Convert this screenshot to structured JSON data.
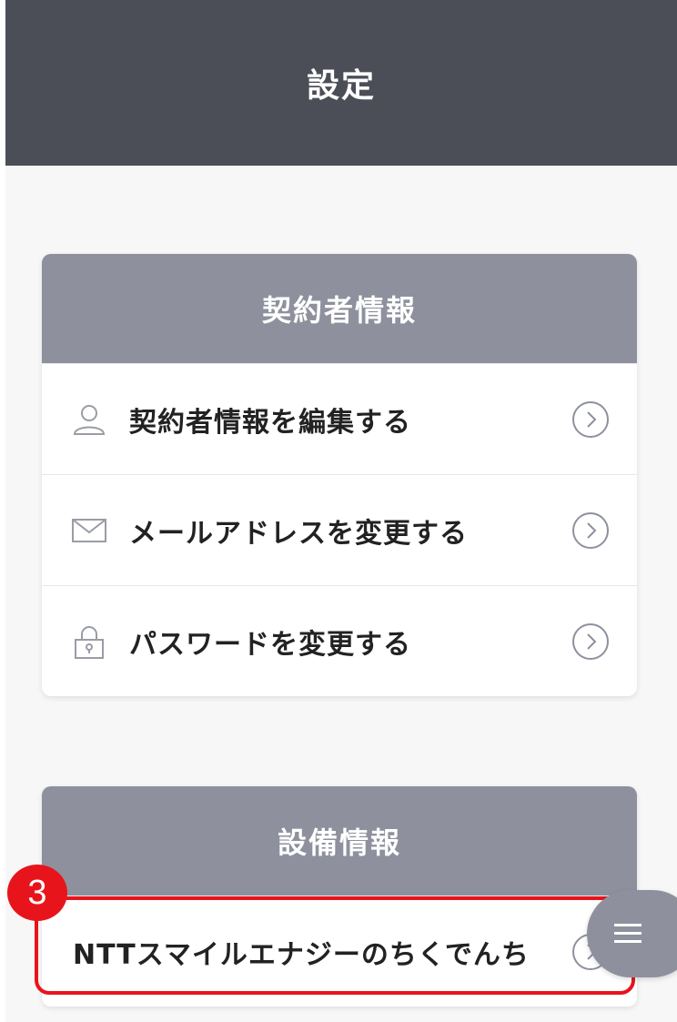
{
  "header": {
    "title": "設定"
  },
  "contract_section": {
    "title": "契約者情報",
    "items": [
      {
        "label": "契約者情報を編集する",
        "icon": "user-icon"
      },
      {
        "label": "メールアドレスを変更する",
        "icon": "mail-icon"
      },
      {
        "label": "パスワードを変更する",
        "icon": "lock-icon"
      }
    ]
  },
  "equipment_section": {
    "title": "設備情報",
    "items": [
      {
        "label": "NTTスマイルエナジーのちくでんち",
        "icon": "chevron-right-icon"
      }
    ]
  },
  "annotation": {
    "step_number": "3",
    "color": "#e8141c"
  },
  "colors": {
    "topbar": "#4b4d57",
    "card_header": "#8e919d",
    "background": "#f7f7f8"
  }
}
